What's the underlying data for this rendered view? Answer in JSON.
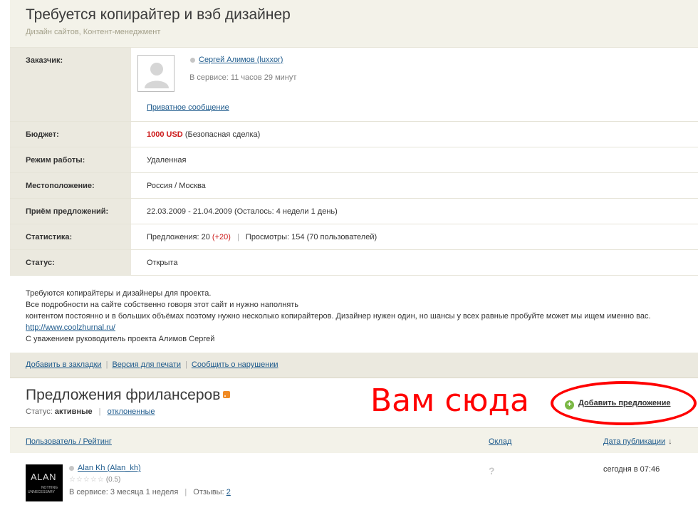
{
  "project": {
    "title": "Требуется копирайтер и вэб дизайнер",
    "subtitle": "Дизайн сайтов, Контент-менеджмент"
  },
  "customer": {
    "label": "Заказчик:",
    "name": "Сергей Алимов (luxxor)",
    "service": "В сервисе: 11 часов 29 минут",
    "private_message": "Приватное сообщение"
  },
  "details": {
    "budget_label": "Бюджет:",
    "budget_amount": "1000 USD",
    "budget_note": "(Безопасная сделка)",
    "mode_label": "Режим работы:",
    "mode_value": "Удаленная",
    "location_label": "Местоположение:",
    "location_value": "Россия / Москва",
    "accept_label": "Приём предложений:",
    "accept_dates": "22.03.2009 - 21.04.2009",
    "accept_remaining": "(Осталось: 4 недели 1 день)",
    "stats_label": "Статистика:",
    "stats_offers": "Предложения: 20",
    "stats_offers_delta": "(+20)",
    "stats_views": "Просмотры: 154 (70 пользователей)",
    "status_label": "Статус:",
    "status_value": "Открыта"
  },
  "description": {
    "line1": "Требуются копирайтеры и дизайнеры для проекта.",
    "line2": "Все подробности на сайте собственно говоря этот сайт и нужно наполнять",
    "line3": "контентом постоянно и в больших объёмах поэтому нужно несколько копирайтеров. Дизайнер нужен один, но шансы у всех равные пробуйте может мы ищем именно вас.",
    "link": "http://www.coolzhurnal.ru/",
    "signature": "С уважением руководитель проекта Алимов Сергей"
  },
  "actions": {
    "bookmark": "Добавить в закладки",
    "print": "Версия для печати",
    "report": "Сообщить о нарушении"
  },
  "offers": {
    "title": "Предложения фрилансеров",
    "status_prefix": "Статус:",
    "status_active": "активные",
    "status_rejected": "отклоненные",
    "annotation": "Вам сюда",
    "add_offer": "Добавить предложение",
    "col_user": "Пользователь / Рейтинг",
    "col_salary": "Оклад",
    "col_date": "Дата публикации"
  },
  "freelancer": {
    "avatar_text": "ALAN",
    "avatar_tagline_1": "NOTHING",
    "avatar_tagline_2": "UNNECESSARY",
    "name": "Alan Kh (Alan_kh)",
    "rating_stars": "☆☆☆☆☆",
    "rating_score": "(0.5)",
    "service": "В сервисе: 3 месяца 1 неделя",
    "reviews_label": "Отзывы:",
    "reviews_count": "2",
    "salary": "?",
    "date": "сегодня в 07:46"
  }
}
